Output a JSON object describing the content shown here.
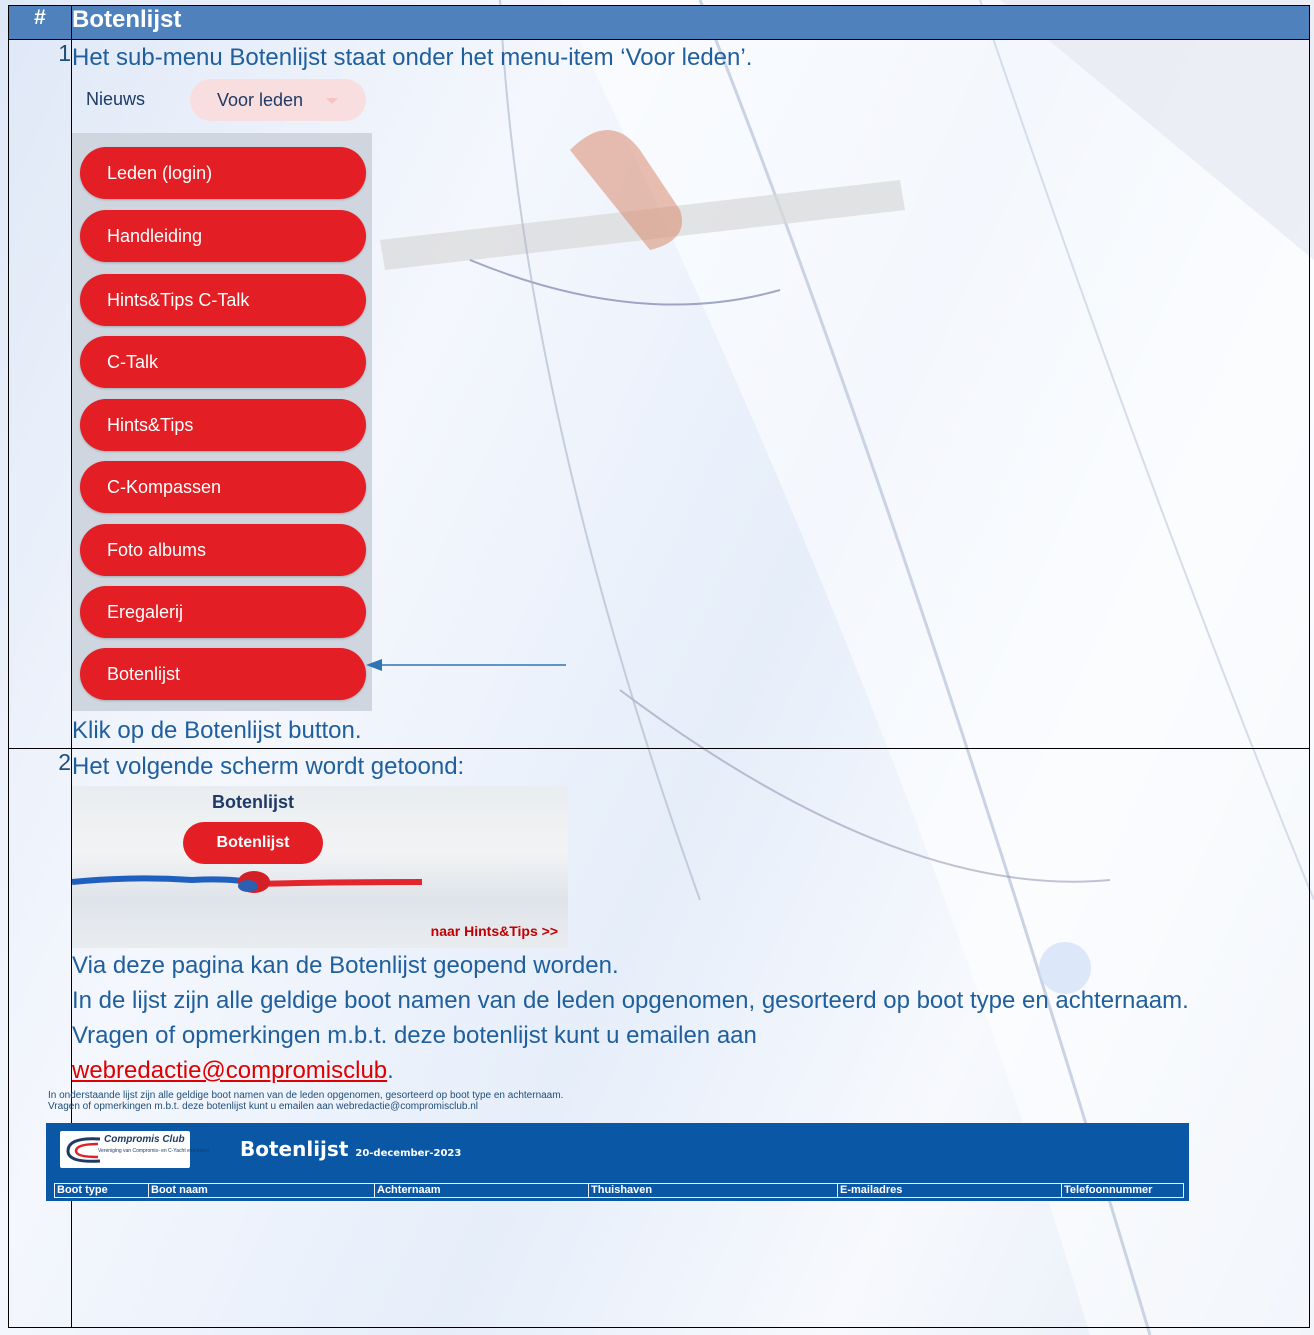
{
  "header": {
    "num_col": "#",
    "title": "Botenlijst"
  },
  "step1": {
    "num": "1",
    "intro": "Het sub-menu Botenlijst staat onder het menu-item ‘Voor leden’.",
    "nav_nieuws": "Nieuws",
    "nav_voor_leden": "Voor leden",
    "submenu": [
      "Leden (login)",
      "Handleiding",
      "Hints&Tips C-Talk",
      "C-Talk",
      "Hints&Tips",
      "C-Kompassen",
      "Foto albums",
      "Eregalerij",
      "Botenlijst"
    ],
    "outro": "Klik op de Botenlijst button."
  },
  "step2": {
    "num": "2",
    "intro": "Het volgende scherm wordt getoond:",
    "card_title": "Botenlijst",
    "card_button": "Botenlijst",
    "card_link": "naar Hints&Tips >>",
    "p1": "Via deze pagina kan de Botenlijst geopend worden.",
    "p2": "In de lijst zijn alle geldige boot namen van de leden opgenomen, gesorteerd op boot type en achternaam.",
    "p3": "Vragen of opmerkingen m.b.t. deze botenlijst kunt u emailen aan",
    "email": "webredactie@compromisclub",
    "period": ".",
    "list_note1": "In onderstaande lijst zijn alle geldige boot namen van de leden opgenomen, gesorteerd op boot type en achternaam.",
    "list_note2": "Vragen of opmerkingen m.b.t. deze botenlijst kunt u emailen aan webredactie@compromisclub.nl",
    "logo_title": "Compromis Club",
    "logo_sub": "Vereniging van Compromis- en C-Yacht eigenaren",
    "list_title": "Botenlijst",
    "list_date": "20-december-2023",
    "columns": [
      "Boot type",
      "Boot naam",
      "Achternaam",
      "Thuishaven",
      "E-mailadres",
      "Telefoonnummer"
    ]
  },
  "colors": {
    "header_bg": "#4f81bd",
    "button_red": "#e31e24",
    "text_blue": "#1f5f9e",
    "link_red": "#e00000",
    "list_bar": "#0a57a6"
  }
}
